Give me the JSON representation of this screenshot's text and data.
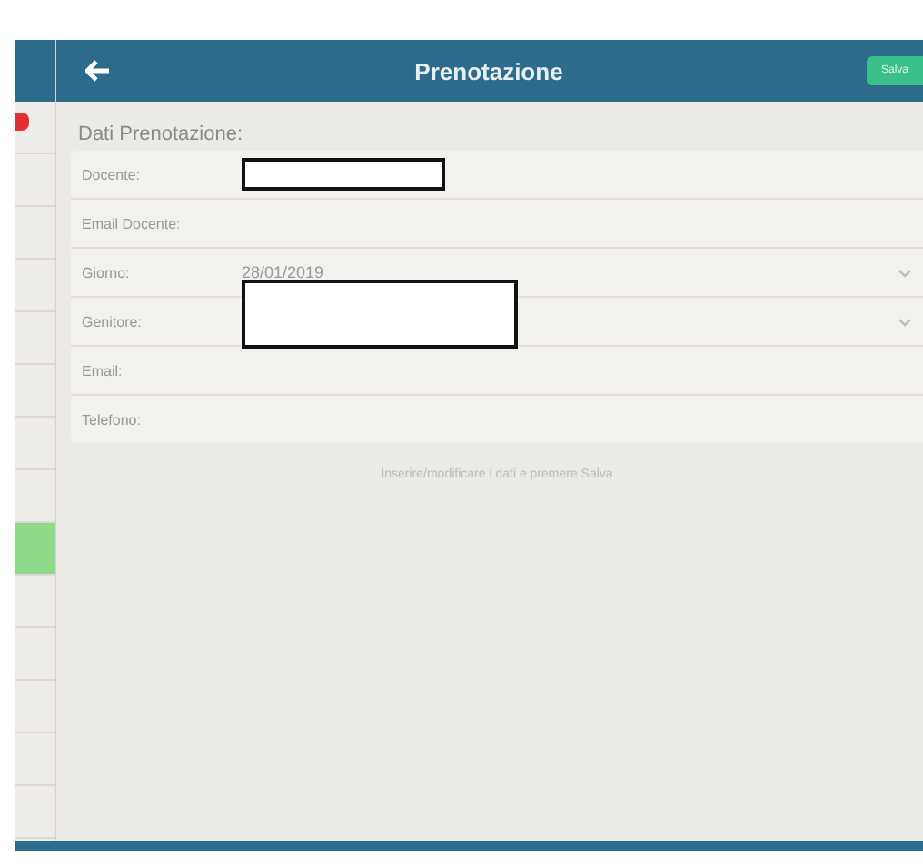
{
  "sidebar": {
    "items": [
      {
        "selected": false
      },
      {
        "selected": false
      },
      {
        "selected": false
      },
      {
        "selected": false
      },
      {
        "selected": false
      },
      {
        "selected": false
      },
      {
        "selected": false
      },
      {
        "selected": false
      },
      {
        "selected": true
      },
      {
        "selected": false
      },
      {
        "selected": false
      },
      {
        "selected": false
      },
      {
        "selected": false
      },
      {
        "selected": false
      }
    ]
  },
  "header": {
    "title": "Prenotazione",
    "save_button": "Salva"
  },
  "section_title": "Dati Prenotazione:",
  "fields": [
    {
      "label": "Docente:",
      "kind": "text",
      "redacted": true
    },
    {
      "label": "Email Docente:",
      "kind": "text",
      "redacted": false
    },
    {
      "label": "Giorno:",
      "kind": "select",
      "value": "28/01/2019",
      "redacted": false
    },
    {
      "label": "Genitore:",
      "kind": "select",
      "redacted": true
    },
    {
      "label": "Email:",
      "kind": "text",
      "redacted": false
    },
    {
      "label": "Telefono:",
      "kind": "text",
      "redacted": false
    }
  ],
  "hint": "Inserire/modificare i dati e premere Salva"
}
